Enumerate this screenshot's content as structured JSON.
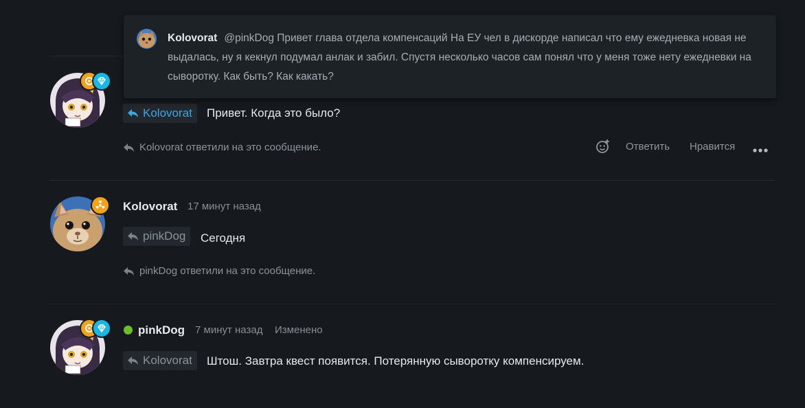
{
  "quote": {
    "author": "Kolovorat",
    "text": "@pinkDog Привет глава отдела компенсаций На ЕУ чел в дискорде написал что ему ежедневка новая не выдалась, ну я кекнул подумал анлак и забил. Спустя несколько часов сам понял что у меня тоже нету ежедневки на сыворотку. Как быть? Как какать?"
  },
  "messages": [
    {
      "reply_to": "Kolovorat",
      "text": "Привет. Когда это было?",
      "replied_note": "Kolovorat ответили на это сообщение.",
      "actions": {
        "react_icon": "add-reaction-icon",
        "reply": "Ответить",
        "like": "Нравится",
        "more_icon": "more-icon"
      }
    },
    {
      "author": "Kolovorat",
      "time": "17 минут назад",
      "reply_to": "pinkDog",
      "text": "Сегодня",
      "replied_note": "pinkDog ответили на это сообщение."
    },
    {
      "author": "pinkDog",
      "time": "7 минут назад",
      "edited": "Изменено",
      "reply_to": "Kolovorat",
      "text": "Штош. Завтра квест появится. Потерянную сыворотку компенсируем."
    }
  ],
  "colors": {
    "background": "#161a1e",
    "accent": "#38a8e8",
    "online": "#6cbd2a",
    "badge_gold": "#f3a21b",
    "badge_cyan": "#19b7e4"
  }
}
